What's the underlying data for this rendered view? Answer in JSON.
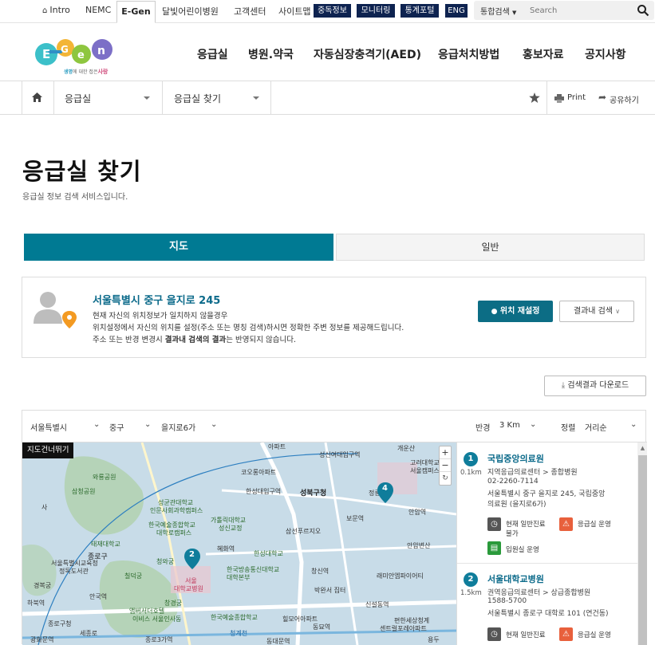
{
  "topbar": {
    "intro": "Intro",
    "nemc": "NEMC",
    "egen": "E-Gen",
    "links": [
      "달빛어린이병원",
      "고객센터",
      "사이트맵"
    ],
    "dark_buttons": [
      "중독정보",
      "모니터링",
      "통계포털",
      "ENG"
    ],
    "search_scope": "통합검색",
    "search_placeholder": "Search"
  },
  "logo": {
    "text": "E-Gen",
    "slogan_a": "생명",
    "slogan_b": "에 대한 접은",
    "slogan_c": "사랑"
  },
  "nav": [
    "응급실",
    "병원.약국",
    "자동심장충격기(AED)",
    "응급처치방법",
    "홍보자료",
    "공지사항"
  ],
  "breadcrumb": {
    "level1": "응급실",
    "level2": "응급실 찾기",
    "print": "Print",
    "share": "공유하기"
  },
  "page": {
    "title": "응급실 찾기",
    "desc": "응급실 정보 검색 서비스입니다."
  },
  "tabs": {
    "map": "지도",
    "general": "일반"
  },
  "location": {
    "address": "서울특별시 중구 을지로 245",
    "line1": "현재 자신의 위치정보가 일치하지 않을경우",
    "line2": "위치설정에서 자신의 위치를 설정(주소 또는 명칭 검색)하시면 정확한 주변 정보를 제공해드립니다.",
    "line3a": "주소 또는 반경 변경시 ",
    "line3b": "결과내 검색의 결과",
    "line3c": "는 반영되지 않습니다.",
    "reset_button": "위치 재설정",
    "filter_button": "결과내 검색"
  },
  "download_button": "검색결과 다운로드",
  "filters": {
    "city": "서울특별시",
    "district": "중구",
    "dong": "을지로6가",
    "radius_label": "반경",
    "radius": "3 Km",
    "sort_label": "정렬",
    "sort": "거리순"
  },
  "map": {
    "skip_label": "지도건너뛰기",
    "labels": [
      {
        "t": "아파트"
      },
      {
        "t": "성신여대입구역"
      },
      {
        "t": "개운산"
      },
      {
        "t": "고려대학교"
      },
      {
        "t": "서울캠퍼스"
      },
      {
        "t": "와룡공원"
      },
      {
        "t": "코오롱아파트"
      },
      {
        "t": "삼청공원"
      },
      {
        "t": "성균관대학교"
      },
      {
        "t": "인문사회과학캠퍼스"
      },
      {
        "t": "한성대입구역"
      },
      {
        "t": "성북구청"
      },
      {
        "t": "정릉"
      },
      {
        "t": "한국예술종합학교"
      },
      {
        "t": "대학로캠퍼스"
      },
      {
        "t": "가톨릭대학교"
      },
      {
        "t": "성신교정"
      },
      {
        "t": "삼선푸르지오"
      },
      {
        "t": "보문역"
      },
      {
        "t": "안암역"
      },
      {
        "t": "태재대학교"
      },
      {
        "t": "종로구"
      },
      {
        "t": "혜화역"
      },
      {
        "t": "한성대학교"
      },
      {
        "t": "서울특별시교육청"
      },
      {
        "t": "정독도서관"
      },
      {
        "t": "청와궁"
      },
      {
        "t": "서울"
      },
      {
        "t": "대학교병원"
      },
      {
        "t": "한국방송통신대학교"
      },
      {
        "t": "대학본부"
      },
      {
        "t": "창신역"
      },
      {
        "t": "래미안엠파이어티"
      },
      {
        "t": "안암변산"
      },
      {
        "t": "경복궁"
      },
      {
        "t": "칠덕궁"
      },
      {
        "t": "신설동역"
      },
      {
        "t": "창경궁"
      },
      {
        "t": "앰버서더호텔"
      },
      {
        "t": "이비스 서울인사동"
      },
      {
        "t": "안국역"
      },
      {
        "t": "종로구청"
      },
      {
        "t": "동묘역"
      },
      {
        "t": "광화문역"
      },
      {
        "t": "종로3가역"
      },
      {
        "t": "동대문역"
      },
      {
        "t": "청계천"
      },
      {
        "t": "하북역"
      },
      {
        "t": "힐모어아파트"
      },
      {
        "t": "한국예술종합학교"
      },
      {
        "t": "박완서 집터"
      },
      {
        "t": "편한세상청계"
      },
      {
        "t": "센트럴포레아파트"
      },
      {
        "t": "용두"
      },
      {
        "t": "세종로"
      },
      {
        "t": "사"
      }
    ],
    "markers": [
      "2",
      "4"
    ],
    "zoom_in": "+",
    "zoom_out": "−"
  },
  "results": [
    {
      "num": "1",
      "distance": "0.1km",
      "name": "국립중앙의료원",
      "type": "지역응급의료센터 > 종합병원",
      "phone": "02-2260-7114",
      "address1": "서울특별시 중구 을지로 245, 국립중앙",
      "address2": "의료원 (을지로6가)",
      "badges": [
        {
          "label": "현재 일반진료",
          "label2": "불가"
        },
        {
          "label": "응급실 운영"
        },
        {
          "label": "입원실 운영"
        }
      ]
    },
    {
      "num": "2",
      "distance": "1.5km",
      "name": "서울대학교병원",
      "type": "권역응급의료센터 > 상급종합병원",
      "phone": "1588-5700",
      "address1": "서울특별시 종로구 대학로 101 (연건동)",
      "badges": [
        {
          "label": "현재 일반진료"
        },
        {
          "label": "응급실 운영"
        }
      ]
    }
  ],
  "colors": {
    "primary": "#007a93",
    "dark_navy": "#0e2350",
    "marker": "#0f7d9b"
  }
}
